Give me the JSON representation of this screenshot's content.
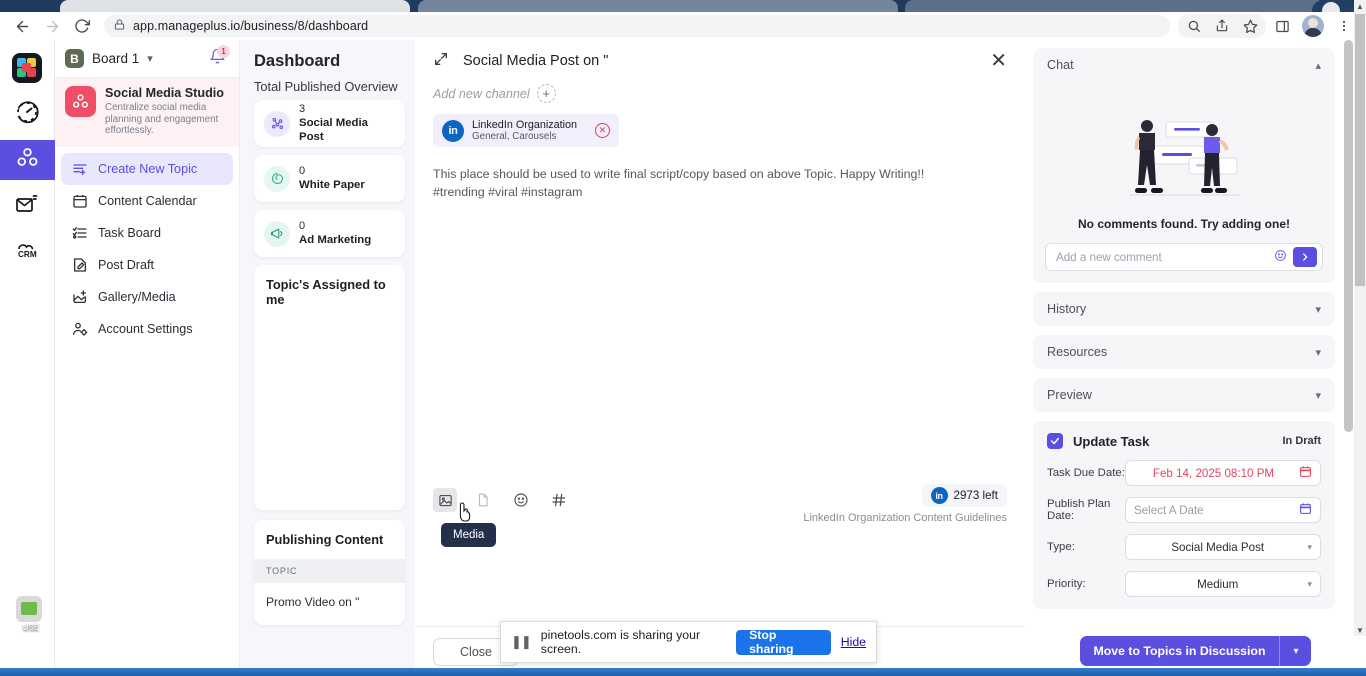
{
  "browser": {
    "url": "app.manageplus.io/business/8/dashboard",
    "back_label": "Back",
    "forward_label": "Forward",
    "reload_label": "Reload",
    "lock_icon": "lock-icon",
    "search_icon": "search-icon",
    "share_icon": "share-icon",
    "bookmark_icon": "star-icon",
    "sidepanel_icon": "side-panel-icon",
    "menu_icon": "kebab-menu-icon"
  },
  "rail": {
    "items": [
      {
        "name": "app-logo",
        "icon": "grid-logo-icon"
      },
      {
        "name": "dashboard",
        "icon": "speedometer-icon"
      },
      {
        "name": "social-media-studio",
        "icon": "molecule-icon",
        "active": true
      },
      {
        "name": "email-marketing",
        "icon": "mail-campaign-icon"
      },
      {
        "name": "crm",
        "icon": "crm-cloud-icon",
        "label": "CRM"
      }
    ]
  },
  "sidebar": {
    "board": {
      "badge": "B",
      "name": "Board 1",
      "chevron": "chevron-down-icon"
    },
    "notifications": {
      "count": "1",
      "icon": "bell-icon"
    },
    "studio": {
      "title": "Social Media Studio",
      "subtitle": "Centralize social media planning and engagement effortlessly.",
      "icon": "molecule-icon"
    },
    "items": [
      {
        "label": "Create New Topic",
        "icon": "list-plus-icon",
        "active": true
      },
      {
        "label": "Content Calendar",
        "icon": "calendar-icon",
        "active": false
      },
      {
        "label": "Task Board",
        "icon": "task-list-icon",
        "active": false
      },
      {
        "label": "Post Draft",
        "icon": "edit-document-icon",
        "active": false
      },
      {
        "label": "Gallery/Media",
        "icon": "image-plus-icon",
        "active": false
      },
      {
        "label": "Account Settings",
        "icon": "user-settings-icon",
        "active": false
      }
    ]
  },
  "dashboard": {
    "title": "Dashboard",
    "overview_label": "Total Published Overview",
    "stats": [
      {
        "count": "3",
        "label": "Social Media Post",
        "icon": "network-icon",
        "bg": "#ede9fb",
        "fg": "#6f5fd8"
      },
      {
        "count": "0",
        "label": "White Paper",
        "icon": "swirl-icon",
        "bg": "#e4f7f0",
        "fg": "#3cab8c"
      },
      {
        "count": "0",
        "label": "Ad Marketing",
        "icon": "megaphone-icon",
        "bg": "#e4f7ef",
        "fg": "#2f9e78"
      }
    ],
    "assigned_panel": {
      "title": "Topic's Assigned to me"
    },
    "publishing_panel": {
      "title": "Publishing Content",
      "column_header": "TOPIC",
      "rows": [
        {
          "topic": "Promo Video on \""
        }
      ]
    }
  },
  "main": {
    "title": "Social Media Post on \"",
    "expand_icon": "expand-diagonal-icon",
    "close_icon": "close-x-icon",
    "add_channel_label": "Add new channel",
    "add_channel_plus": "+",
    "channel": {
      "name": "LinkedIn Organization",
      "meta": "General, Carousels",
      "icon": "linkedin-icon",
      "remove_icon": "remove-circle-icon"
    },
    "editor_lines": [
      "This place should be used to write final script/copy based on above Topic. Happy Writing!!",
      "#trending #viral #instagram"
    ],
    "tools": [
      {
        "name": "media-tool",
        "icon": "image-icon",
        "pressed": true
      },
      {
        "name": "document-tool",
        "icon": "file-icon",
        "pressed": false
      },
      {
        "name": "emoji-tool",
        "icon": "smiley-icon",
        "pressed": false
      },
      {
        "name": "hashtag-tool",
        "icon": "hashtag-icon",
        "pressed": false
      }
    ],
    "tooltip": "Media",
    "quota": {
      "count": "2973 left",
      "icon": "linkedin-icon",
      "guidelines": "LinkedIn Organization Content Guidelines"
    },
    "close_button": "Close"
  },
  "inspector": {
    "sections": [
      {
        "label": "Chat",
        "expanded": true,
        "chevron": "chevron-up-icon"
      },
      {
        "label": "History",
        "expanded": false,
        "chevron": "chevron-down-icon"
      },
      {
        "label": "Resources",
        "expanded": false,
        "chevron": "chevron-down-icon"
      },
      {
        "label": "Preview",
        "expanded": false,
        "chevron": "chevron-down-icon"
      }
    ],
    "chat": {
      "empty_text": "No comments found. Try adding one!",
      "input_placeholder": "Add a new comment",
      "emoji_icon": "smiley-icon",
      "send_icon": "send-arrow-icon",
      "illustration": "two-people-chat-illustration"
    },
    "task": {
      "checkbox_checked": true,
      "title": "Update Task",
      "status": "In Draft",
      "fields": [
        {
          "label": "Task Due Date:",
          "value": "Feb 14, 2025 08:10 PM",
          "icon": "calendar-icon",
          "highlight": true,
          "type": "date"
        },
        {
          "label": "Publish Plan Date:",
          "value": "Select A Date",
          "icon": "calendar-icon",
          "highlight": false,
          "type": "date",
          "placeholder": true
        },
        {
          "label": "Type:",
          "value": "Social Media Post",
          "icon": "chevron-down-icon",
          "highlight": false,
          "type": "select"
        },
        {
          "label": "Priority:",
          "value": "Medium",
          "icon": "chevron-down-icon",
          "highlight": false,
          "type": "select"
        }
      ]
    },
    "cta": {
      "label": "Move to Topics in Discussion",
      "chevron": "chevron-down-icon"
    }
  },
  "share_bar": {
    "pause_icon": "pause-icon",
    "message": "pinetools.com is sharing your screen.",
    "stop_label": "Stop sharing",
    "hide_label": "Hide"
  },
  "desktop": {
    "icon_label": "USE",
    "icon_name": "image-file-icon"
  },
  "colors": {
    "accent": "#5a4fe0",
    "danger": "#e0455f",
    "linkedin": "#0a66c2",
    "chrome_blue": "#1a73e8"
  }
}
